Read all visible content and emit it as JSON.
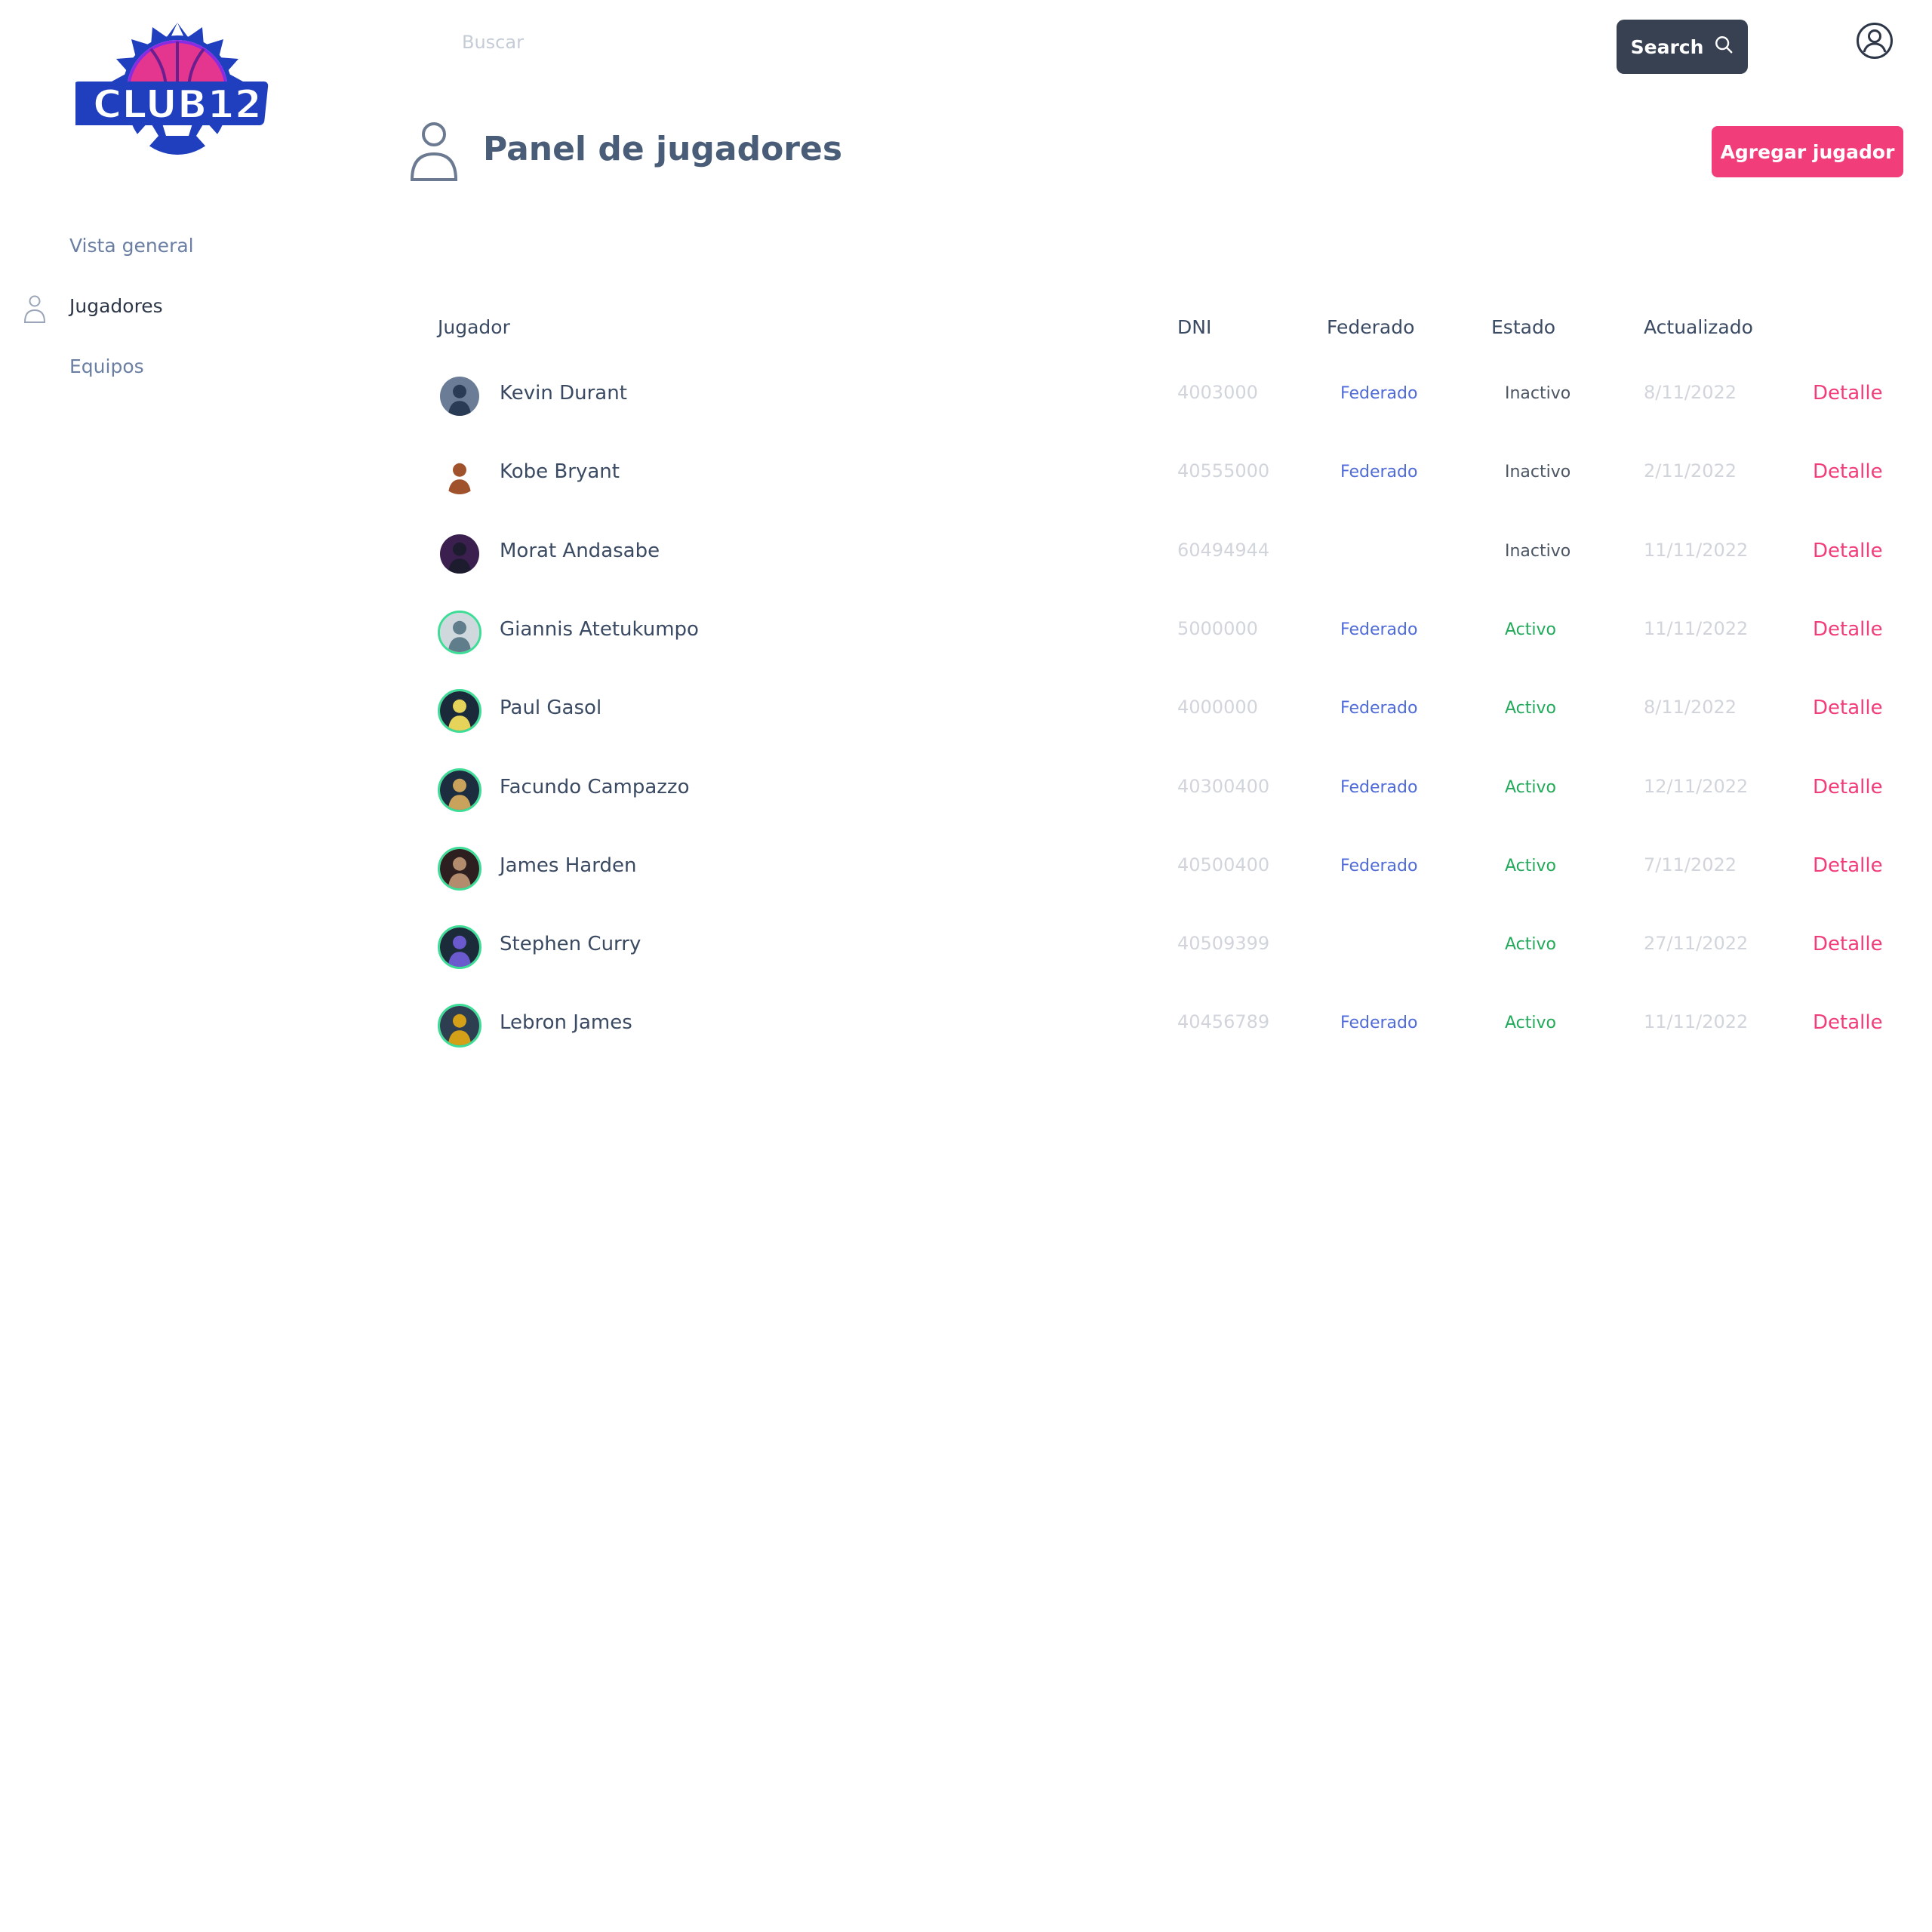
{
  "brand": {
    "logo_text": "CLUB12"
  },
  "topbar": {
    "search_placeholder": "Buscar",
    "search_button": "Search"
  },
  "sidebar": {
    "items": [
      {
        "label": "Vista general"
      },
      {
        "label": "Jugadores"
      },
      {
        "label": "Equipos"
      }
    ]
  },
  "header": {
    "title": "Panel de jugadores",
    "add_button": "Agregar jugador"
  },
  "table": {
    "columns": [
      "Jugador",
      "DNI",
      "Federado",
      "Estado",
      "Actualizado"
    ],
    "rows": [
      {
        "name": "Kevin Durant",
        "dni": "4003000",
        "federado": "Federado",
        "estado": "Inactivo",
        "updated": "8/11/2022",
        "action": "Detalle"
      },
      {
        "name": "Kobe Bryant",
        "dni": "40555000",
        "federado": "Federado",
        "estado": "Inactivo",
        "updated": "2/11/2022",
        "action": "Detalle"
      },
      {
        "name": "Morat Andasabe",
        "dni": "60494944",
        "federado": "",
        "estado": "Inactivo",
        "updated": "11/11/2022",
        "action": "Detalle"
      },
      {
        "name": "Giannis Atetukumpo",
        "dni": "5000000",
        "federado": "Federado",
        "estado": "Activo",
        "updated": "11/11/2022",
        "action": "Detalle"
      },
      {
        "name": "Paul Gasol",
        "dni": "4000000",
        "federado": "Federado",
        "estado": "Activo",
        "updated": "8/11/2022",
        "action": "Detalle"
      },
      {
        "name": "Facundo Campazzo",
        "dni": "40300400",
        "federado": "Federado",
        "estado": "Activo",
        "updated": "12/11/2022",
        "action": "Detalle"
      },
      {
        "name": "James Harden",
        "dni": "40500400",
        "federado": "Federado",
        "estado": "Activo",
        "updated": "7/11/2022",
        "action": "Detalle"
      },
      {
        "name": "Stephen Curry",
        "dni": "40509399",
        "federado": "",
        "estado": "Activo",
        "updated": "27/11/2022",
        "action": "Detalle"
      },
      {
        "name": "Lebron James",
        "dni": "40456789",
        "federado": "Federado",
        "estado": "Activo",
        "updated": "11/11/2022",
        "action": "Detalle"
      }
    ]
  },
  "colors": {
    "accent": "#f13d7a",
    "dark_button": "#374151",
    "federado": "#4f6bd8",
    "activo": "#22a95a",
    "inactivo": "#4b5563",
    "avatar_ring": "#3ddc97",
    "logo_blue": "#1f3fbf",
    "logo_pink": "#e4358f"
  }
}
